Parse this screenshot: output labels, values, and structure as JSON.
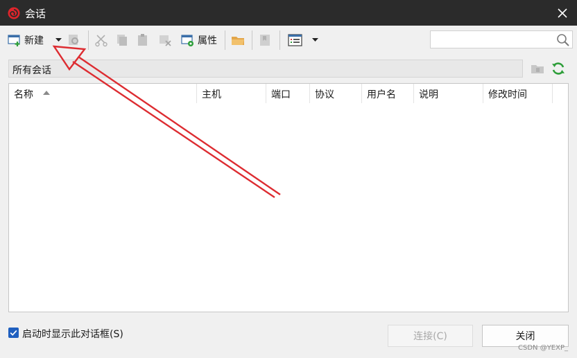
{
  "window": {
    "title": "会话",
    "accent_color": "#e0242b"
  },
  "toolbar": {
    "new_label": "新建",
    "properties_label": "属性",
    "icons": [
      "new-session-icon",
      "dropdown-icon",
      "find-icon",
      "cut-icon",
      "copy-icon",
      "paste-icon",
      "delete-icon",
      "properties-icon",
      "folder-icon",
      "bookmark-icon",
      "view-icon",
      "dropdown-icon"
    ]
  },
  "search": {
    "value": "",
    "placeholder": ""
  },
  "path": {
    "text": "所有会话"
  },
  "list": {
    "columns": [
      "名称",
      "主机",
      "端口",
      "协议",
      "用户名",
      "说明",
      "修改时间"
    ],
    "rows": []
  },
  "footer": {
    "show_on_startup_label": "启动时显示此对话框(S)",
    "show_on_startup_checked": true,
    "connect_label": "连接(C)",
    "close_label": "关闭"
  },
  "watermark": "CSDN @YEXP_"
}
